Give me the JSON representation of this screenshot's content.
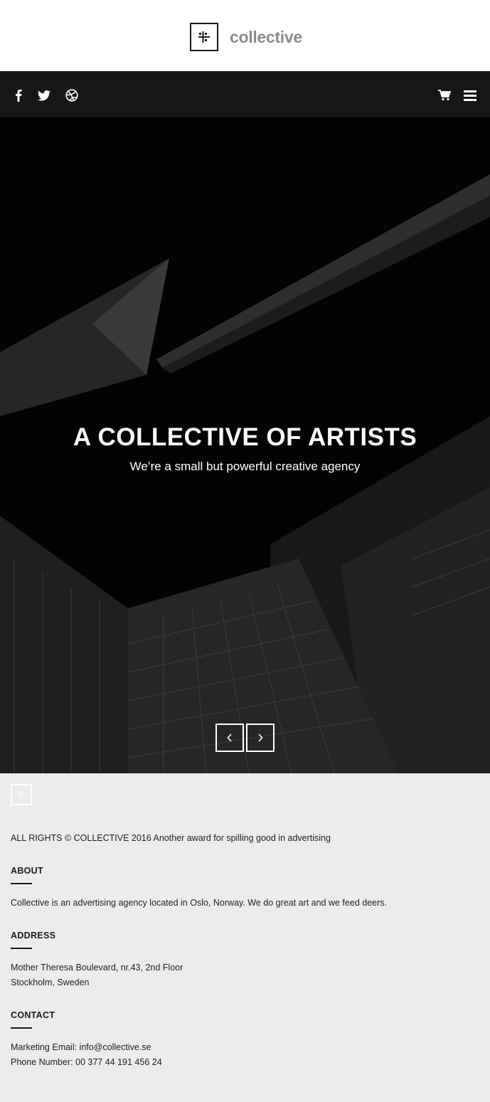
{
  "brand": {
    "name": "collective"
  },
  "nav": {
    "social_icons": [
      "facebook-icon",
      "twitter-icon",
      "dribbble-icon"
    ],
    "right_icons": [
      "cart-icon",
      "menu-icon"
    ]
  },
  "hero": {
    "title": "A COLLECTIVE OF ARTISTS",
    "subtitle": "We’re a small but powerful creative agency",
    "prev_icon": "chevron-left-icon",
    "next_icon": "chevron-right-icon"
  },
  "footer": {
    "copyright": "ALL RIGHTS © COLLECTIVE 2016 Another award for spilling good in advertising",
    "about": {
      "heading": "ABOUT",
      "text": "Collective is an advertising agency located in Oslo, Norway. We do great art and we feed deers."
    },
    "address": {
      "heading": "ADDRESS",
      "line1": "Mother Theresa Boulevard, nr.43, 2nd Floor",
      "line2": "Stockholm, Sweden"
    },
    "contact": {
      "heading": "CONTACT",
      "email": "Marketing Email: info@collective.se",
      "phone": "Phone Number: 00 377 44 191 456 24"
    }
  },
  "colors": {
    "header_bg": "#ffffff",
    "nav_bg": "#161616",
    "hero_bg": "#030303",
    "footer_bg": "#ececec",
    "brand_grey": "#8c8c8c"
  }
}
